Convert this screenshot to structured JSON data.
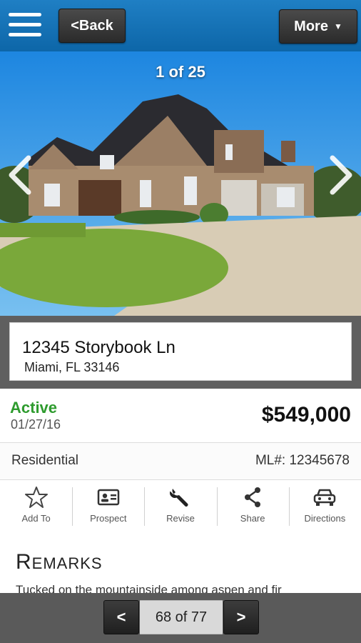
{
  "header": {
    "menu_icon": "hamburger-menu-icon",
    "back_label": "<Back",
    "more_label": "More",
    "more_caret": "▼"
  },
  "photo": {
    "counter": "1 of 25",
    "prev_icon": "chevron-left-icon",
    "next_icon": "chevron-right-icon"
  },
  "address": {
    "line1": "12345 Storybook Ln",
    "line2": "Miami, FL 33146"
  },
  "listing": {
    "status": "Active",
    "status_color": "#2e9b2e",
    "date": "01/27/16",
    "price": "$549,000",
    "type": "Residential",
    "mls": "ML#: 12345678"
  },
  "actions": [
    {
      "label": "Add To",
      "icon": "star-icon"
    },
    {
      "label": "Prospect",
      "icon": "contact-card-icon"
    },
    {
      "label": "Revise",
      "icon": "wrench-icon"
    },
    {
      "label": "Share",
      "icon": "share-icon"
    },
    {
      "label": "Directions",
      "icon": "car-icon"
    }
  ],
  "remarks": {
    "title_first": "R",
    "title_rest": "EMARKS",
    "text": "Tucked on the mountainside among aspen and fir"
  },
  "pager": {
    "prev_label": "<",
    "count": "68 of 77",
    "next_label": ">"
  }
}
